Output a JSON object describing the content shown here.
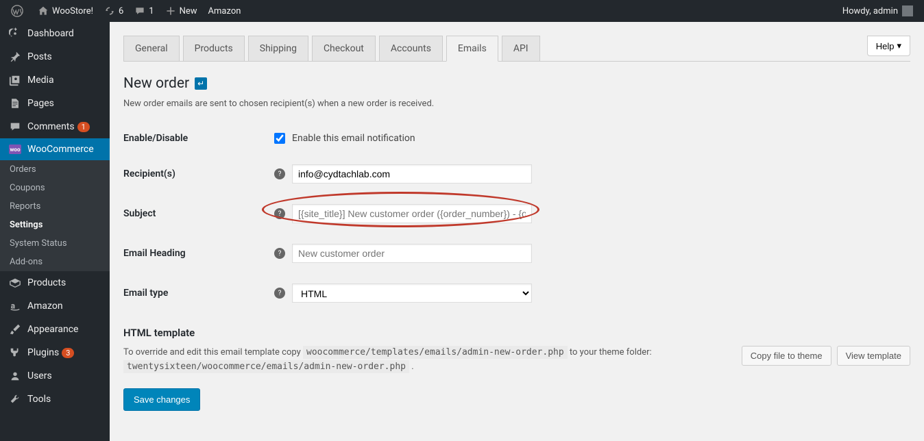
{
  "admin_bar": {
    "site_name": "WooStore!",
    "updates_count": "6",
    "comments_count": "1",
    "new_label": "New",
    "amazon_label": "Amazon",
    "howdy": "Howdy, admin"
  },
  "sidebar": {
    "items": [
      {
        "label": "Dashboard",
        "icon": "dashboard"
      },
      {
        "label": "Posts",
        "icon": "pin"
      },
      {
        "label": "Media",
        "icon": "media"
      },
      {
        "label": "Pages",
        "icon": "pages"
      },
      {
        "label": "Comments",
        "icon": "comment",
        "badge": "1"
      },
      {
        "label": "WooCommerce",
        "icon": "woo",
        "current": true
      },
      {
        "label": "Products",
        "icon": "products"
      },
      {
        "label": "Amazon",
        "icon": "amazon"
      },
      {
        "label": "Appearance",
        "icon": "brush"
      },
      {
        "label": "Plugins",
        "icon": "plug",
        "badge": "3"
      },
      {
        "label": "Users",
        "icon": "users"
      },
      {
        "label": "Tools",
        "icon": "tools"
      }
    ],
    "submenu": [
      {
        "label": "Orders"
      },
      {
        "label": "Coupons"
      },
      {
        "label": "Reports"
      },
      {
        "label": "Settings",
        "current": true
      },
      {
        "label": "System Status"
      },
      {
        "label": "Add-ons"
      }
    ]
  },
  "tabs": [
    {
      "label": "General"
    },
    {
      "label": "Products"
    },
    {
      "label": "Shipping"
    },
    {
      "label": "Checkout"
    },
    {
      "label": "Accounts"
    },
    {
      "label": "Emails",
      "active": true
    },
    {
      "label": "API"
    }
  ],
  "help_label": "Help",
  "page": {
    "title": "New order",
    "description": "New order emails are sent to chosen recipient(s) when a new order is received."
  },
  "form": {
    "enable_label": "Enable/Disable",
    "enable_checkbox": "Enable this email notification",
    "enable_checked": true,
    "recipients_label": "Recipient(s)",
    "recipients_value": "info@cydtachlab.com",
    "subject_label": "Subject",
    "subject_placeholder": "[{site_title}] New customer order ({order_number}) - {or",
    "heading_label": "Email Heading",
    "heading_placeholder": "New customer order",
    "type_label": "Email type",
    "type_value": "HTML"
  },
  "template": {
    "title": "HTML template",
    "override_prefix": "To override and edit this email template copy",
    "path1": "woocommerce/templates/emails/admin-new-order.php",
    "override_mid": "to your theme folder:",
    "path2": "twentysixteen/woocommerce/emails/admin-new-order.php",
    "copy_btn": "Copy file to theme",
    "view_btn": "View template"
  },
  "save_button": "Save changes"
}
